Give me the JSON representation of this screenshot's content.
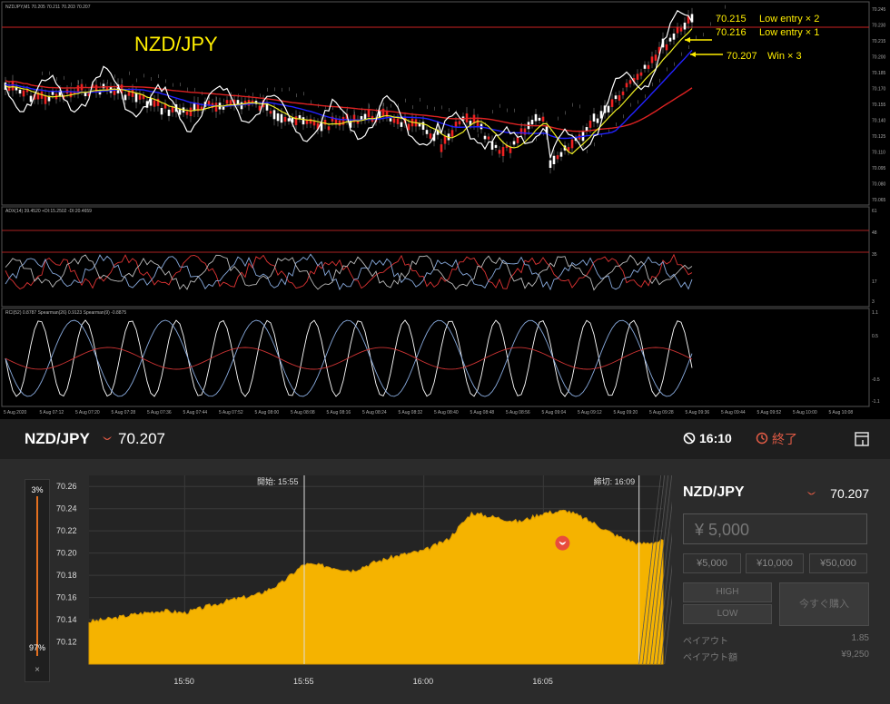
{
  "mt4": {
    "top_info": "NZDJPY,M1 70.205 70.211 70.203 70.207",
    "watermark": "NZD/JPY",
    "annotations": [
      {
        "price": "70.215",
        "text": "Low entry × 2"
      },
      {
        "price": "70.216",
        "text": "Low entry × 1"
      },
      {
        "price": "70.207",
        "text": "Win × 3"
      }
    ],
    "price_axis": [
      "70.245",
      "70.230",
      "70.215",
      "70.200",
      "70.185",
      "70.170",
      "70.155",
      "70.140",
      "70.125",
      "70.110",
      "70.095",
      "70.080",
      "70.065"
    ],
    "adx_label": "ADX(14) 39.4520 +DI:15.2502 -DI:20.4659",
    "adx_axis": [
      "61",
      "48",
      "35",
      "17",
      "3"
    ],
    "rci_label": "RCI(52) 0.8787 Spearman(26) 0.9123 Spearman(9) -0.8875",
    "rci_axis": [
      "1.1",
      "0.5",
      "-0.5",
      "-1.1"
    ],
    "time_axis": [
      "5 Aug 2020",
      "5 Aug 07:12",
      "5 Aug 07:20",
      "5 Aug 07:28",
      "5 Aug 07:36",
      "5 Aug 07:44",
      "5 Aug 07:52",
      "5 Aug 08:00",
      "5 Aug 08:08",
      "5 Aug 08:16",
      "5 Aug 08:24",
      "5 Aug 08:32",
      "5 Aug 08:40",
      "5 Aug 08:48",
      "5 Aug 08:56",
      "5 Aug 09:04",
      "5 Aug 09:12",
      "5 Aug 09:20",
      "5 Aug 09:28",
      "5 Aug 09:36",
      "5 Aug 09:44",
      "5 Aug 09:52",
      "5 Aug 10:00",
      "5 Aug 10:08"
    ]
  },
  "app": {
    "pair": "NZD/JPY",
    "price": "70.207",
    "timer": "16:10",
    "end_label": "終了",
    "sidebar": {
      "top": "3%",
      "bottom": "97%",
      "close": "×"
    },
    "chart_data": {
      "type": "area",
      "ylim": [
        70.1,
        70.27
      ],
      "yticks": [
        "70.26",
        "70.24",
        "70.22",
        "70.20",
        "70.18",
        "70.16",
        "70.14",
        "70.12"
      ],
      "xticks": [
        "15:50",
        "15:55",
        "16:00",
        "16:05"
      ],
      "start_label": "開始: 15:55",
      "close_label": "締切: 16:09",
      "x": [
        "15:46",
        "15:47",
        "15:48",
        "15:49",
        "15:50",
        "15:51",
        "15:52",
        "15:53",
        "15:54",
        "15:55",
        "15:56",
        "15:57",
        "15:58",
        "15:59",
        "16:00",
        "16:01",
        "16:02",
        "16:03",
        "16:04",
        "16:05",
        "16:06",
        "16:07",
        "16:08",
        "16:09",
        "16:10"
      ],
      "values": [
        70.138,
        70.141,
        70.145,
        70.148,
        70.146,
        70.152,
        70.158,
        70.162,
        70.172,
        70.19,
        70.188,
        70.184,
        70.192,
        70.198,
        70.202,
        70.212,
        70.236,
        70.232,
        70.228,
        70.236,
        70.238,
        70.228,
        70.216,
        70.208,
        70.211
      ],
      "entry_price": 70.209,
      "fill_color": "#f5b300"
    },
    "panel": {
      "pair": "NZD/JPY",
      "price": "70.207",
      "amount_placeholder": "¥ 5,000",
      "quick": [
        "¥5,000",
        "¥10,000",
        "¥50,000"
      ],
      "high": "HIGH",
      "low": "LOW",
      "buy": "今すぐ購入",
      "payout_label": "ペイアウト",
      "payout_value": "1.85",
      "payout_amount_label": "ペイアウト額",
      "payout_amount_value": "¥9,250"
    }
  }
}
